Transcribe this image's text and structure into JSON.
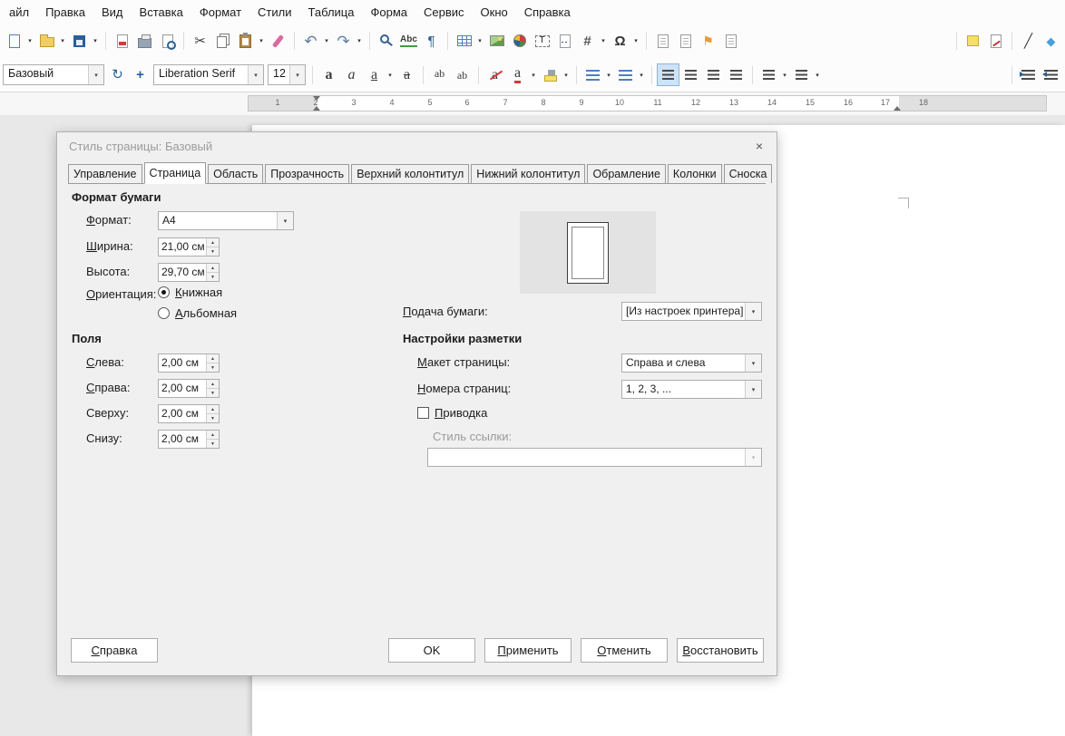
{
  "menubar": {
    "items": [
      "айл",
      "Правка",
      "Вид",
      "Вставка",
      "Формат",
      "Стили",
      "Таблица",
      "Форма",
      "Сервис",
      "Окно",
      "Справка"
    ]
  },
  "formatting": {
    "style_value": "Базовый",
    "font_name": "Liberation Serif",
    "font_size": "12"
  },
  "ruler": {
    "numbers": [
      "1",
      "2",
      "3",
      "4",
      "5",
      "6",
      "7",
      "8",
      "9",
      "10",
      "11",
      "12",
      "13",
      "14",
      "15",
      "16",
      "17",
      "18"
    ]
  },
  "icons": {
    "dropdown": "▾",
    "spin_up": "▲",
    "spin_down": "▼",
    "close": "×",
    "cut": "✂",
    "undo": "↶",
    "redo": "↷",
    "update": "↻",
    "plus": "+",
    "paragraph_mark": "¶",
    "omega": "Ω",
    "hash": "#",
    "textbox": "T",
    "spelling": "Abc",
    "letter": "а",
    "superscript": "ab",
    "subscript": "ab",
    "line": "╱",
    "diamond": "◆",
    "flag": "⚑"
  },
  "dialog": {
    "title": "Стиль страницы: Базовый",
    "tabs": [
      "Управление",
      "Страница",
      "Область",
      "Прозрачность",
      "Верхний колонтитул",
      "Нижний колонтитул",
      "Обрамление",
      "Колонки",
      "Сноска"
    ],
    "paper": {
      "section_title": "Формат бумаги",
      "format_label": "Формат:",
      "format_value": "A4",
      "width_label": "Ширина:",
      "width_value": "21,00 см",
      "height_label": "Высота:",
      "height_value": "29,70 см",
      "orientation_label": "Ориентация:",
      "portrait": "Книжная",
      "landscape": "Альбомная",
      "tray_label": "Подача бумаги:",
      "tray_value": "[Из настроек принтера]"
    },
    "margins": {
      "section_title": "Поля",
      "left_label": "Слева:",
      "left_value": "2,00 см",
      "right_label": "Справа:",
      "right_value": "2,00 см",
      "top_label": "Сверху:",
      "top_value": "2,00 см",
      "bottom_label": "Снизу:",
      "bottom_value": "2,00 см"
    },
    "layout": {
      "section_title": "Настройки разметки",
      "page_layout_label": "Макет страницы:",
      "page_layout_value": "Справа и слева",
      "numbers_label": "Номера страниц:",
      "numbers_value": "1, 2, 3, ...",
      "register_label": "Приводка",
      "ref_style_label": "Стиль ссылки:"
    },
    "buttons": {
      "help": "Справка",
      "ok": "OK",
      "apply": "Применить",
      "cancel": "Отменить",
      "reset": "Восстановить"
    }
  }
}
